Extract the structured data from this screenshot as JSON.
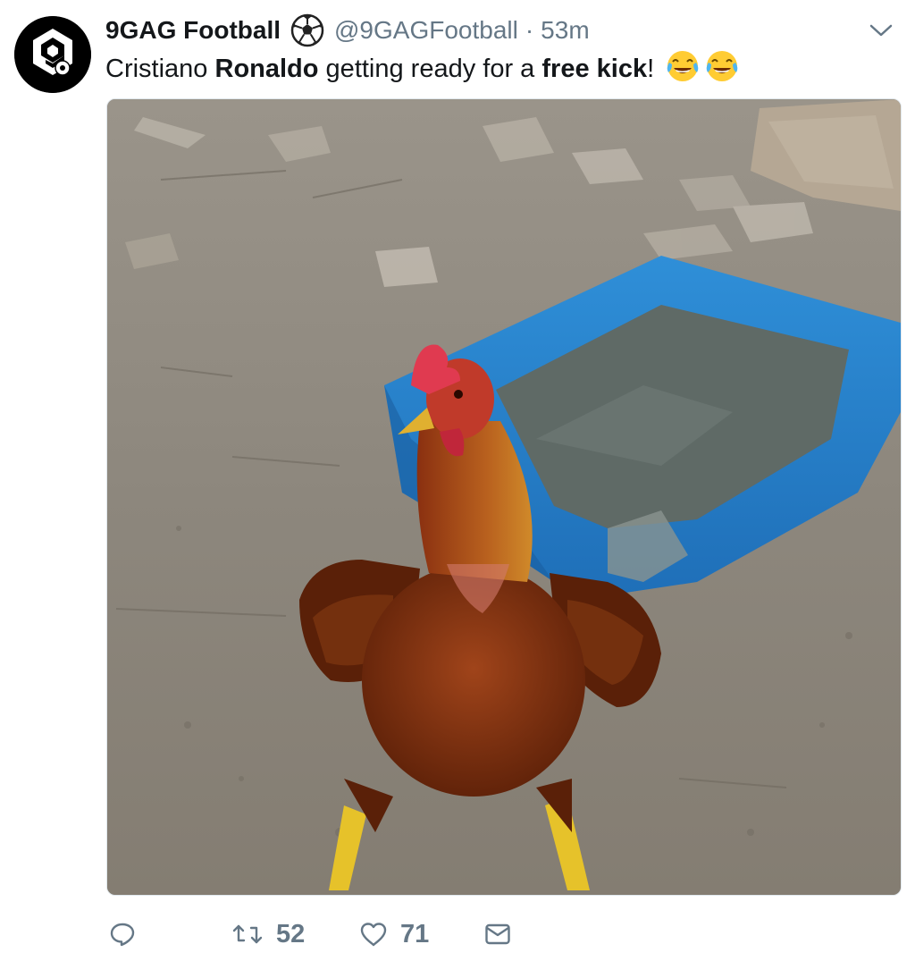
{
  "tweet": {
    "display_name": "9GAG Football",
    "badge_icon": "soccer-ball-icon",
    "handle": "@9GAGFootball",
    "separator": "·",
    "time": "53m",
    "text": {
      "part1": "Cristiano ",
      "bold1": "Ronaldo",
      "part2": " getting ready for a ",
      "bold2": "free kick",
      "part3": "!"
    },
    "emojis": [
      "face-with-tears-of-joy-emoji",
      "face-with-tears-of-joy-emoji"
    ]
  },
  "actions": {
    "reply": {
      "icon": "reply-icon",
      "count": ""
    },
    "retweet": {
      "icon": "retweet-icon",
      "count": "52"
    },
    "like": {
      "icon": "heart-icon",
      "count": "71"
    },
    "message": {
      "icon": "envelope-icon",
      "count": ""
    }
  },
  "menu": {
    "icon": "chevron-down-icon"
  },
  "colors": {
    "text": "#14171a",
    "secondary": "#657786",
    "border": "#e1e8ed"
  }
}
